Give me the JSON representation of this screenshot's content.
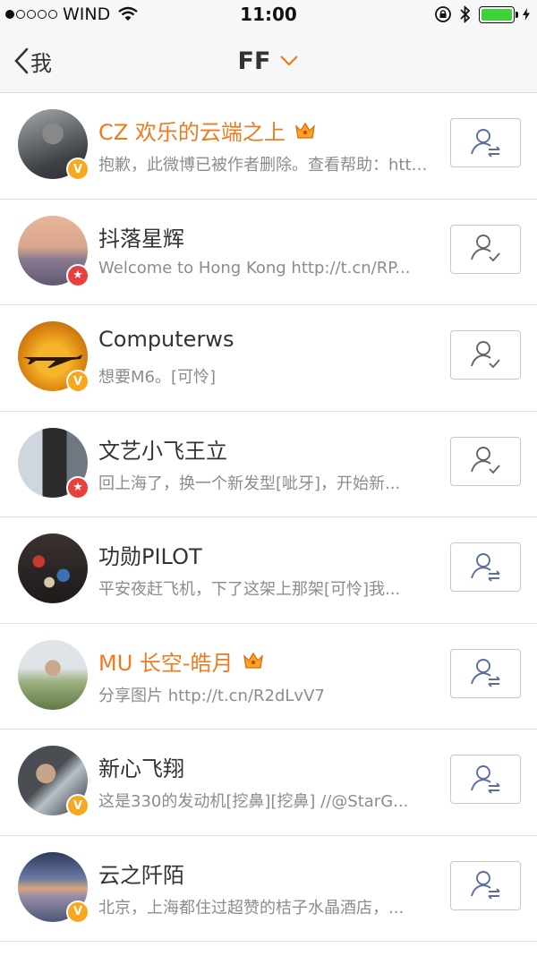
{
  "status_bar": {
    "carrier": "WIND",
    "time": "11:00"
  },
  "nav": {
    "back_label": "我",
    "title": "FF"
  },
  "colors": {
    "vip_name": "#eb7b20",
    "verified_badge": "#f7a81c",
    "star_badge": "#e8403f",
    "battery": "#3fd13a"
  },
  "users": [
    {
      "name": "CZ 欢乐的云端之上",
      "vip": true,
      "badge": "verified",
      "follow_state": "mutual-follow-icon",
      "description": "抱歉，此微博已被作者删除。查看帮助：http://t.cn/..."
    },
    {
      "name": "抖落星辉",
      "vip": false,
      "badge": "star",
      "follow_state": "following-icon",
      "description": "Welcome to Hong Kong http://t.cn/RP..."
    },
    {
      "name": "Computerws",
      "vip": false,
      "badge": "verified",
      "follow_state": "following-icon",
      "description": "想要M6。[可怜]"
    },
    {
      "name": "文艺小飞王立",
      "vip": false,
      "badge": "star",
      "follow_state": "following-icon",
      "description": "回上海了，换一个新发型[呲牙]，开始新..."
    },
    {
      "name": "功勋PILOT",
      "vip": false,
      "badge": "none",
      "follow_state": "mutual-follow-icon",
      "description": "平安夜赶飞机，下了这架上那架[可怜]我..."
    },
    {
      "name": "MU 长空-皓月",
      "vip": true,
      "badge": "none",
      "follow_state": "mutual-follow-icon",
      "description": "分享图片 http://t.cn/R2dLvV7"
    },
    {
      "name": "新心飞翔",
      "vip": false,
      "badge": "verified",
      "follow_state": "mutual-follow-icon",
      "description": "这是330的发动机[挖鼻][挖鼻] //@StarG..."
    },
    {
      "name": "云之阡陌",
      "vip": false,
      "badge": "verified",
      "follow_state": "mutual-follow-icon",
      "description": "北京，上海都住过超赞的桔子水晶酒店，..."
    }
  ]
}
